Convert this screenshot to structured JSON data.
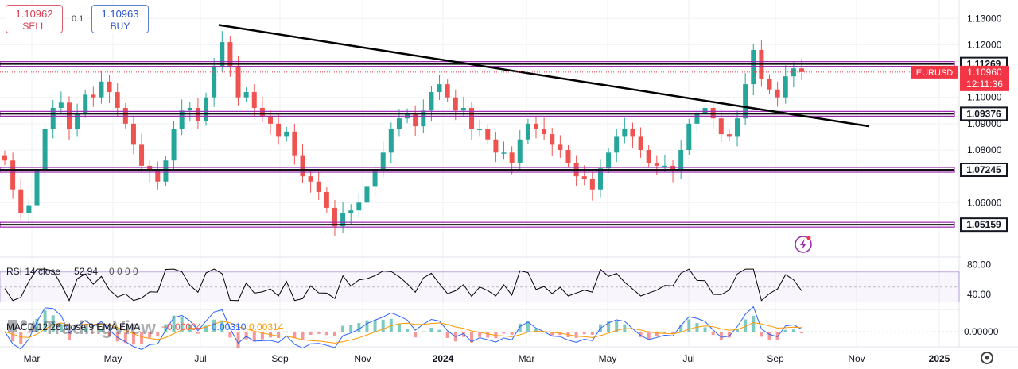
{
  "trade_panel": {
    "sell_price": "1.10962",
    "sell_label": "SELL",
    "quantity": "0.1",
    "buy_price": "1.10963",
    "buy_label": "BUY"
  },
  "symbol_label": "EURUSD",
  "current_price": "1.10960",
  "countdown": "12:11:36",
  "watermark": "TradingView",
  "colors": {
    "up": "#26a69a",
    "down": "#ef5350",
    "level_line": "#111111",
    "level_band": "#9c27b0",
    "symbol_badge": "#f23645",
    "rsi_line": "#000000",
    "rsi_band": "#7e57c2",
    "macd_line": "#2962ff",
    "signal_line": "#ff9800"
  },
  "chart_data": [
    {
      "type": "candlestick",
      "symbol": "EURUSD",
      "x_ticks": [
        "Mar",
        "May",
        "Jul",
        "Sep",
        "Nov",
        "2024",
        "Mar",
        "May",
        "Jul",
        "Sep",
        "Nov",
        "2025"
      ],
      "y_ticks": [
        "1.13000",
        "1.12000",
        "1.10000",
        "1.09000",
        "1.08000",
        "1.06000"
      ],
      "ylim": [
        1.045,
        1.134
      ],
      "price_levels": [
        "1.11269",
        "1.09376",
        "1.07245",
        "1.05159"
      ],
      "trendline": {
        "from": [
          "2023-07-13",
          1.1275
        ],
        "to": [
          "2024-11-05",
          1.089
        ]
      },
      "closes": [
        1.076,
        1.065,
        1.056,
        1.059,
        1.072,
        1.088,
        1.096,
        1.098,
        1.088,
        1.094,
        1.101,
        1.1,
        1.106,
        1.102,
        1.096,
        1.09,
        1.082,
        1.074,
        1.072,
        1.068,
        1.076,
        1.088,
        1.095,
        1.096,
        1.091,
        1.1,
        1.112,
        1.121,
        1.112,
        1.1,
        1.102,
        1.096,
        1.093,
        1.09,
        1.085,
        1.087,
        1.078,
        1.07,
        1.068,
        1.064,
        1.058,
        1.051,
        1.056,
        1.057,
        1.06,
        1.066,
        1.072,
        1.079,
        1.088,
        1.092,
        1.094,
        1.089,
        1.095,
        1.102,
        1.105,
        1.1,
        1.095,
        1.096,
        1.088,
        1.088,
        1.084,
        1.079,
        1.079,
        1.075,
        1.084,
        1.09,
        1.088,
        1.086,
        1.082,
        1.08,
        1.075,
        1.07,
        1.069,
        1.065,
        1.073,
        1.079,
        1.085,
        1.088,
        1.085,
        1.08,
        1.075,
        1.074,
        1.074,
        1.072,
        1.08,
        1.09,
        1.094,
        1.096,
        1.092,
        1.086,
        1.085,
        1.092,
        1.105,
        1.118,
        1.107,
        1.103,
        1.1,
        1.108,
        1.111,
        1.1096
      ],
      "rsi": {
        "label": "RSI 14 close",
        "value": "52.94",
        "extra": "0 0 0 0",
        "y_ticks": [
          "80.00",
          "40.00"
        ],
        "levels": [
          70,
          30
        ],
        "ylim": [
          20,
          90
        ]
      },
      "macd": {
        "label": "MACD 12 26 close 9 EMA EMA",
        "histogram": "−0.00004",
        "macd": "0.00310",
        "signal": "0.00314",
        "y_ticks": [
          "0.00000"
        ]
      }
    }
  ]
}
